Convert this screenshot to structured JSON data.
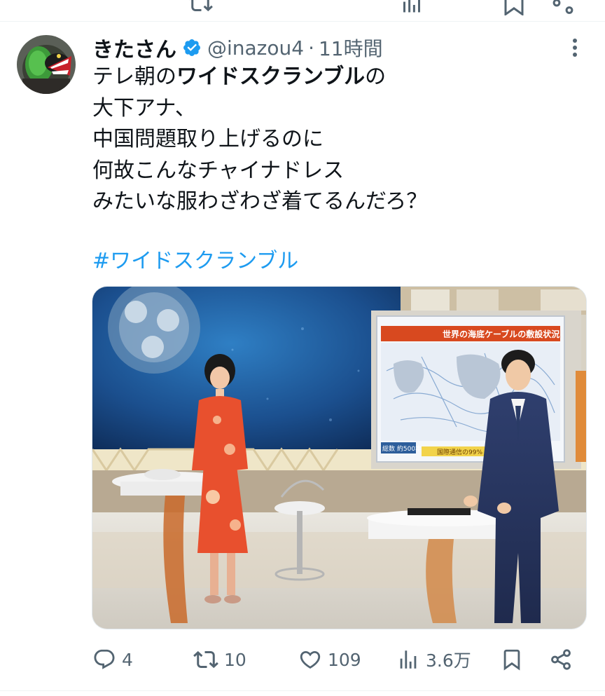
{
  "author": {
    "display_name": "きたさん",
    "handle": "@inazou4",
    "separator": "·",
    "time": "11時間",
    "verified": true
  },
  "tweet": {
    "lines": [
      {
        "pre": "テレ朝の",
        "bold": "ワイドスクランブル",
        "post": "の"
      },
      {
        "text": "大下アナ、"
      },
      {
        "text": "中国問題取り上げるのに"
      },
      {
        "text": "何故こんなチャイナドレス"
      },
      {
        "text": "みたいな服わざわざ着てるんだろ？"
      }
    ],
    "hashtag": "#ワイドスクランブル"
  },
  "media": {
    "screen_title": "世界の海底ケーブルの敷設状況",
    "screen_total": "総数 約500本",
    "screen_intl": "国際通信の99%"
  },
  "actions": {
    "replies": "4",
    "retweets": "10",
    "likes": "109",
    "views": "3.6万"
  },
  "colors": {
    "accent": "#1d9bf0",
    "text": "#0f1419",
    "muted": "#536471",
    "divider": "#eff3f4"
  },
  "icons": [
    "reply-icon",
    "retweet-icon",
    "like-icon",
    "views-icon",
    "bookmark-icon",
    "share-icon",
    "more-icon",
    "verified-badge-icon"
  ]
}
